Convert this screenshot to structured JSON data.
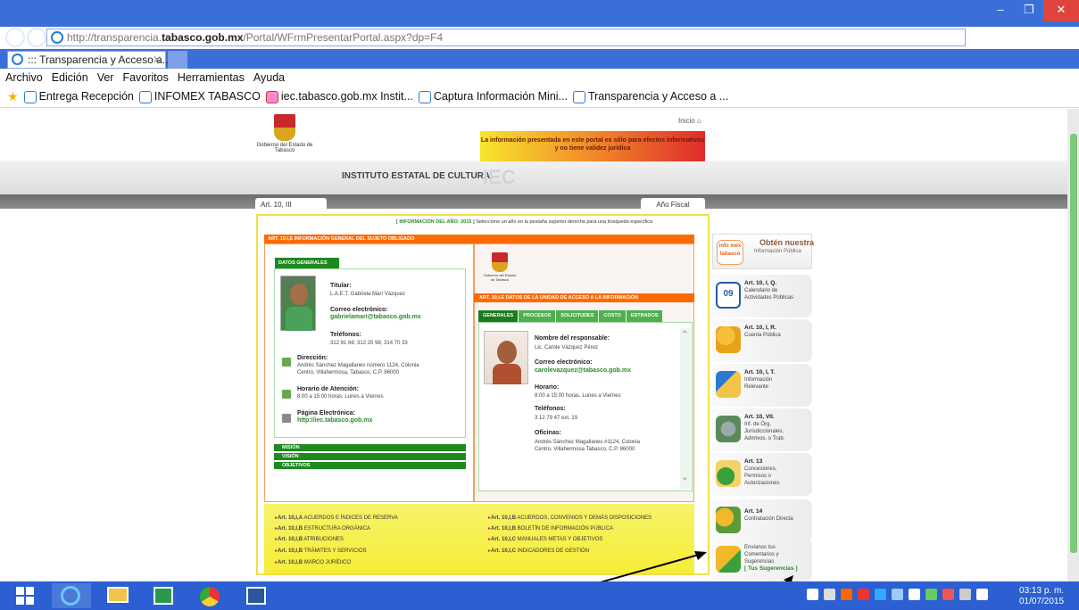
{
  "browser": {
    "url_prefix": "http://transparencia.",
    "url_domain": "tabasco.gob.mx",
    "url_suffix": "/Portal/WFrmPresentarPortal.aspx?dp=F4",
    "search_symbol": "⌕ ▾ ↻",
    "tab_title": "::: Transparencia y Acceso a...",
    "menu": [
      "Archivo",
      "Edición",
      "Ver",
      "Favoritos",
      "Herramientas",
      "Ayuda"
    ],
    "favorites": [
      "Entrega Recepción",
      "INFOMEX TABASCO",
      "iec.tabasco.gob.mx Instit...",
      "Captura Información Mini...",
      "Transparencia y Acceso a ..."
    ]
  },
  "header": {
    "logo_text": "Gobierno del Estado de Tabasco",
    "inicio": "Inicio",
    "notice": "La información presentada en este portal es sólo para efectos informativos y no tiene validez jurídica",
    "institute": "INSTITUTO ESTATAL DE CULTURA",
    "acronym": "IEC",
    "tab_left": "Art. 10, III",
    "tab_right": "Año Fiscal"
  },
  "content": {
    "year_badge": "[ INFORMACIÓN DEL AÑO: 2015 ]",
    "year_hint": "Seleccione un año en la pestaña superior derecha para una búsqueda específica",
    "left_header": "ART. 10,I,E INFORMACIÓN GENERAL DEL SUJETO OBLIGADO",
    "datos_generales": "DATOS GENERALES",
    "titular_label": "Titular:",
    "titular_value": "L.A.E.T. Gabriela Marí Vázquez",
    "email_label": "Correo electrónico:",
    "email_value": "gabrielamari@tabasco.gob.mx",
    "tel_label": "Teléfonos:",
    "tel_value": "312 91 66; 312 25 98; 314 70 33",
    "dir_label": "Dirección:",
    "dir_line1": "Andrés Sánchez Magallanes número 1124, Colonia",
    "dir_line2": "Centro, Villahermosa, Tabasco, C.P. 86000",
    "horario_label": "Horario de Atención:",
    "horario_value": "8:00 a 15:00 horas. Lunes a Viernes",
    "web_label": "Página Electrónica:",
    "web_value": "http://iec.tabasco.gob.mx",
    "mision": "MISIÓN",
    "vision": "VISIÓN",
    "objetivos": "OBJETIVOS",
    "right_header": "ART. 10,I,E DATOS DE LA UNIDAD DE ACCESO A LA INFORMACIÓN",
    "right_tabs": [
      "GENERALES",
      "PROCESOS",
      "SOLICITUDES",
      "COSTO",
      "ESTRADOS"
    ],
    "resp_label": "Nombre del responsable:",
    "resp_value": "Lic. Carole Vázquez Pérez",
    "email2_label": "Correo electrónico:",
    "email2_value": "carolevazquez@tabasco.gob.mx",
    "horario2_label": "Horario:",
    "horario2_value": "8:00 a 15:00 horas. Lunes a Viernes",
    "tel2_label": "Teléfonos:",
    "tel2_value": "3 12 79 47 ext. 19",
    "ofi_label": "Oficinas:",
    "ofi_line1": "Andrés Sánchez Magallanes #1124, Colonia",
    "ofi_line2": "Centro, Villahermosa Tabasco, C.P. 86000"
  },
  "links": [
    {
      "art": "Art. 10,I,A",
      "text": "ACUERDOS E ÍNDICES DE RESERVA"
    },
    {
      "art": "Art. 10,I,B",
      "text": "ESTRUCTURA ORGÁNICA"
    },
    {
      "art": "Art. 10,I,B",
      "text": "ATRIBUCIONES"
    },
    {
      "art": "Art. 10,I,B",
      "text": "TRÁMITES Y SERVICIOS"
    },
    {
      "art": "Art. 10,I,B",
      "text": "MARCO JURÍDICO"
    },
    {
      "art": "Art. 10,I,B",
      "text": "ACUERDOS, CONVENIOS Y DEMÁS DISPOSICIONES"
    },
    {
      "art": "Art. 10,I,B",
      "text": "BOLETÍN DE INFORMACIÓN PÚBLICA"
    },
    {
      "art": "Art. 10,I,C",
      "text": "MANUALES METAS Y OBJETIVOS"
    },
    {
      "art": "Art. 10,I,C",
      "text": "INDICADORES DE GESTIÓN"
    }
  ],
  "sidebar": {
    "infomex_logo": "info mex tabasco",
    "infomex_text1": "Obtén nuestra",
    "infomex_text2": "Información Pública",
    "items": [
      {
        "title": "Art. 10, I, Q.",
        "l1": "Calendario de",
        "l2": "Actividades Públicas",
        "l3": "",
        "l4": ""
      },
      {
        "title": "Art. 10, I, R.",
        "l1": "Cuenta Pública",
        "l2": "",
        "l3": "",
        "l4": ""
      },
      {
        "title": "Art. 10, I, T.",
        "l1": "Información",
        "l2": "Relevante",
        "l3": "",
        "l4": ""
      },
      {
        "title": "Art. 10, VII.",
        "l1": "Inf. de Órg.",
        "l2": "Jurisdiccionales,",
        "l3": "Admtvos. o Trab.",
        "l4": ""
      },
      {
        "title": "Art. 13",
        "l1": "Concesiones,",
        "l2": "Permisos o",
        "l3": "Autorizaciones",
        "l4": ""
      },
      {
        "title": "Art. 14",
        "l1": "Contratación Directa",
        "l2": "",
        "l3": "",
        "l4": ""
      },
      {
        "title": "",
        "l1": "Envíanos tus",
        "l2": "Comentarios y",
        "l3": "Sugerencias",
        "l4": "[ Tus Sugerencias ]"
      }
    ],
    "calendar_day": "09"
  },
  "taskbar": {
    "time": "03:13 p. m.",
    "date": "01/07/2015"
  },
  "colors": {
    "accent": "#ff6a00",
    "green": "#1e8a1e",
    "titlebar": "#3a6fd8"
  }
}
